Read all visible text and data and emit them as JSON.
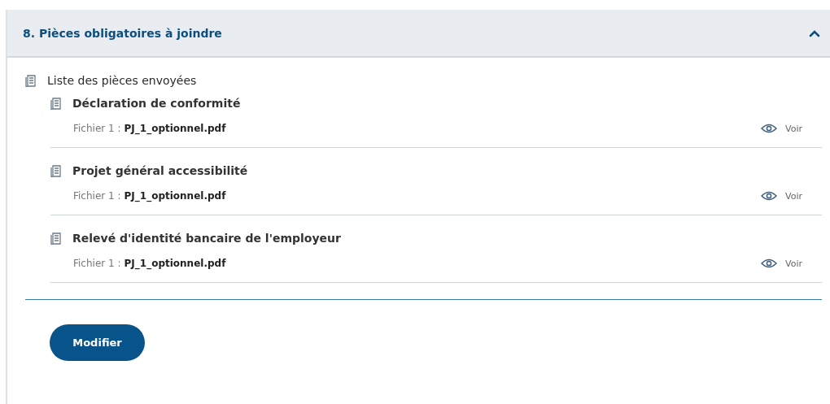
{
  "section": {
    "title": "8. Pièces obligatoires à joindre",
    "expanded": true
  },
  "list": {
    "title": "Liste des pièces envoyées",
    "documents": [
      {
        "title": "Déclaration de conformité",
        "file_label": "Fichier 1 :",
        "file_name": "PJ_1_optionnel.pdf",
        "action": "Voir"
      },
      {
        "title": "Projet général accessibilité",
        "file_label": "Fichier 1 :",
        "file_name": "PJ_1_optionnel.pdf",
        "action": "Voir"
      },
      {
        "title": "Relevé d'identité bancaire de l'employeur",
        "file_label": "Fichier 1 :",
        "file_name": "PJ_1_optionnel.pdf",
        "action": "Voir"
      }
    ]
  },
  "button": "Modifier"
}
